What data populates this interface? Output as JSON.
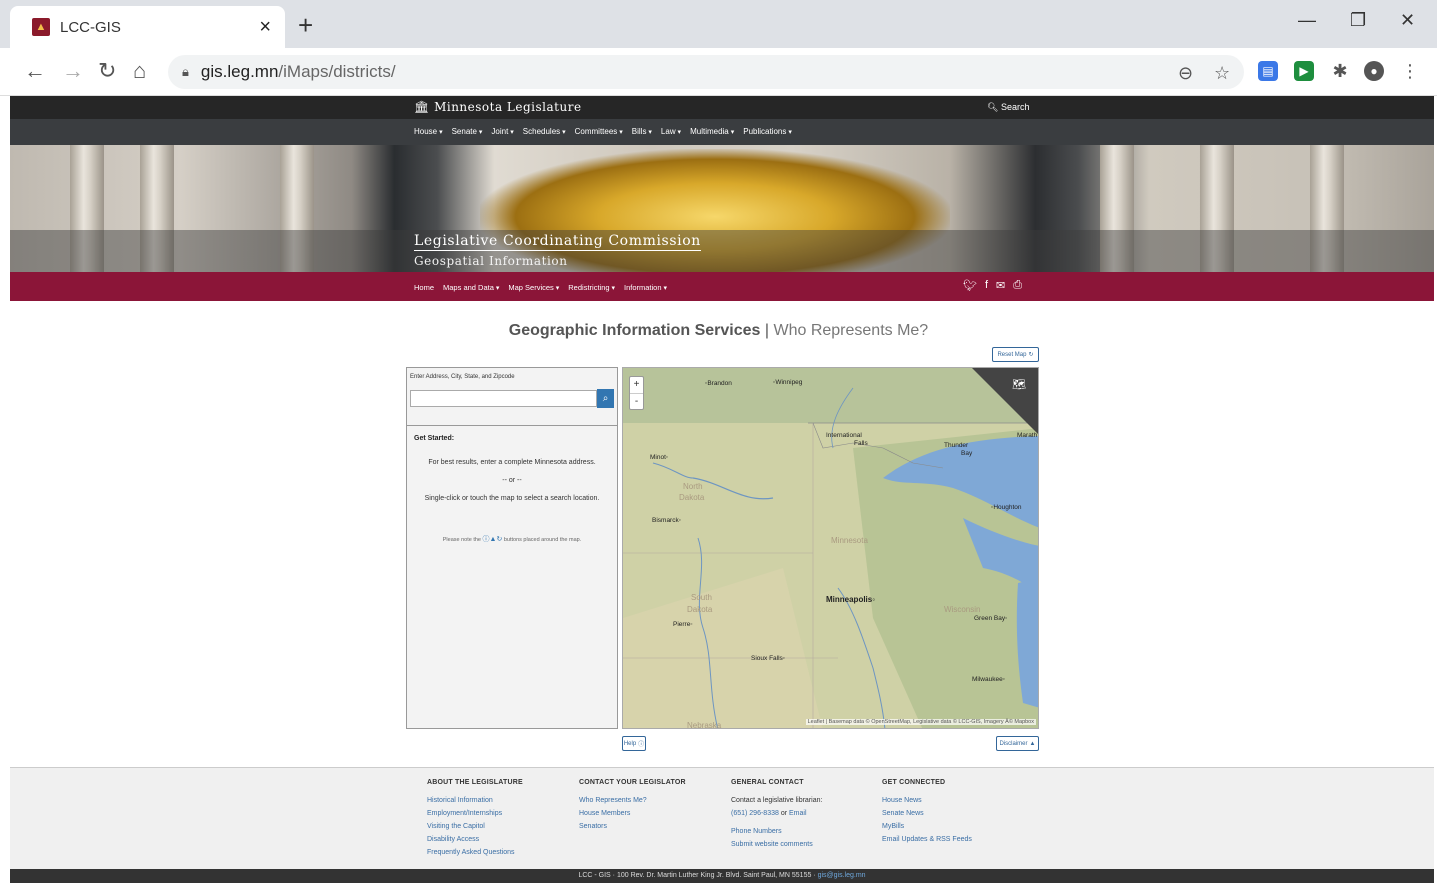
{
  "browser": {
    "tab_title": "LCC-GIS",
    "url_host": "gis.leg.mn",
    "url_path": "/iMaps/districts/"
  },
  "site": {
    "brand": "Minnesota Legislature",
    "search_label": "Search",
    "main_nav": [
      "House",
      "Senate",
      "Joint",
      "Schedules",
      "Committees",
      "Bills",
      "Law",
      "Multimedia",
      "Publications"
    ],
    "hero_title": "Legislative Coordinating Commission",
    "hero_subtitle": "Geospatial Information",
    "sub_nav": [
      "Home",
      "Maps and Data",
      "Map Services",
      "Redistricting",
      "Information"
    ]
  },
  "main": {
    "heading": "Geographic Information Services",
    "heading_sep": "|",
    "heading_sub": "Who Represents Me?",
    "reset_label": "Reset Map",
    "address_label": "Enter Address, City, State, and Zipcode",
    "address_value": "",
    "get_started_title": "Get Started:",
    "gs_line1": "For best results, enter a complete Minnesota address.",
    "gs_line2": "-- or --",
    "gs_line3": "Single-click or touch the map to select a search location.",
    "gs_note_pre": "Please note the",
    "gs_note_post": "buttons placed around the map.",
    "help_label": "Help",
    "disclaimer_label": "Disclaimer",
    "map": {
      "zoom_in": "+",
      "zoom_out": "-",
      "labels": {
        "brandon": "Brandon",
        "winnipeg": "Winnipeg",
        "intl_falls_1": "International",
        "intl_falls_2": "Falls",
        "thunder_bay_1": "Thunder",
        "thunder_bay_2": "Bay",
        "marathon": "Marath",
        "minot": "Minot",
        "north_dakota_1": "North",
        "north_dakota_2": "Dakota",
        "bismarck": "Bismarck",
        "houghton": "Houghton",
        "minnesota": "Minnesota",
        "south_dakota_1": "South",
        "south_dakota_2": "Dakota",
        "pierre": "Pierre",
        "minneapolis": "Minneapolis",
        "wisconsin": "Wisconsin",
        "green_bay": "Green Bay",
        "sioux_falls": "Sioux Falls",
        "milwaukee": "Milwaukee",
        "nebraska": "Nebraska"
      },
      "attribution": "Leaflet | Basemap data © OpenStreetMap, Legislative data © LCC-GIS, Imagery Â© Mapbox"
    }
  },
  "footer": {
    "col1": {
      "title": "ABOUT THE LEGISLATURE",
      "links": [
        "Historical Information",
        "Employment/Internships",
        "Visiting the Capitol",
        "Disability Access",
        "Frequently Asked Questions"
      ]
    },
    "col2": {
      "title": "CONTACT YOUR LEGISLATOR",
      "links": [
        "Who Represents Me?",
        "House Members",
        "Senators"
      ]
    },
    "col3": {
      "title": "GENERAL CONTACT",
      "contact_text": "Contact a legislative librarian:",
      "phone": "(651) 296-8338",
      "or": "or",
      "email": "Email",
      "phone_numbers": "Phone Numbers",
      "submit_comments": "Submit website comments"
    },
    "col4": {
      "title": "GET CONNECTED",
      "links": [
        "House News",
        "Senate News",
        "MyBills",
        "Email Updates & RSS Feeds"
      ]
    },
    "address_line": "LCC - GIS · 100 Rev. Dr. Martin Luther King Jr. Blvd. Saint Paul, MN 55155 ·",
    "address_email": "gis@gis.leg.mn"
  }
}
